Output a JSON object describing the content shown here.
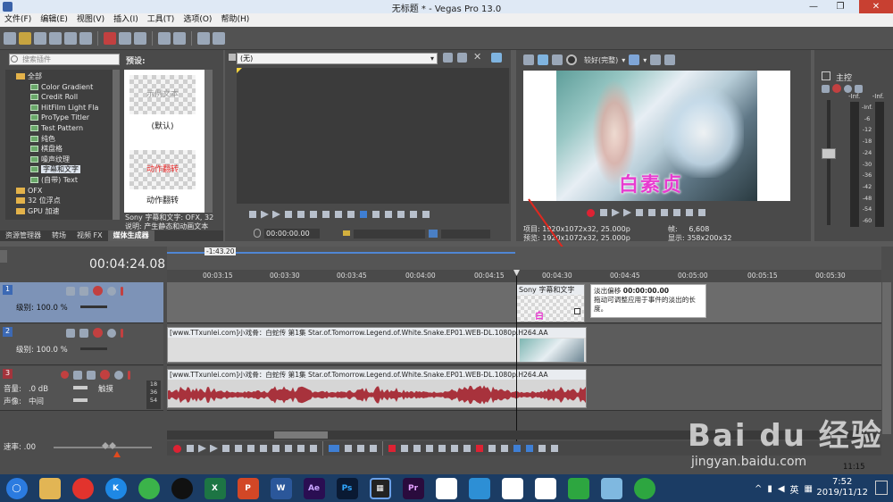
{
  "window": {
    "title": "无标题 * - Vegas Pro 13.0"
  },
  "menu": [
    "文件(F)",
    "编辑(E)",
    "视图(V)",
    "插入(I)",
    "工具(T)",
    "选项(O)",
    "帮助(H)"
  ],
  "explorer": {
    "search_placeholder": "搜索插件",
    "preset_label": "预设:",
    "tree": [
      "全部",
      "Color Gradient",
      "Credit Roll",
      "HitFilm Light Fla",
      "ProType Titler",
      "Test Pattern",
      "纯色",
      "棋盘格",
      "噪声纹理",
      "字幕和文字",
      "(自带) Text",
      "OFX",
      "32 位浮点",
      "GPU 加速"
    ],
    "presets": [
      {
        "thumb_text": "示例文本",
        "label": "(默认)"
      },
      {
        "thumb_text": "动作翻转",
        "label": "动作翻转"
      }
    ],
    "info_line1": "Sony 字幕和文字: OFX, 32",
    "info_line2": "说明: 产生静态和动画文本",
    "tabs": [
      "资源管理器",
      "转场",
      "视频 FX",
      "媒体生成器"
    ]
  },
  "trimmer": {
    "dropdown_value": "(无)",
    "timecode": "00:00:00.00"
  },
  "preview": {
    "quality": "较好(完整)",
    "caption": "白素贞",
    "project_label": "项目:",
    "project_value": "1920x1072x32, 25.000p",
    "preview_label": "预览:",
    "preview_value": "1920x1072x32, 25.000p",
    "frame_label": "帧:",
    "frame_value": "6,608",
    "display_label": "显示:",
    "display_value": "358x200x32"
  },
  "master": {
    "label": "主控",
    "scale": [
      "-Inf.",
      "-6",
      "-12",
      "-18",
      "-24",
      "-30",
      "-36",
      "-42",
      "-48",
      "-54",
      "-60"
    ],
    "top_values": [
      "-Inf.",
      "-Inf."
    ]
  },
  "timeline": {
    "time": "00:04:24.08",
    "region_label": "-1:43.20",
    "ticks": [
      "00:03:15",
      "00:03:30",
      "00:03:45",
      "00:04:00",
      "00:04:15",
      "00:04:30",
      "00:04:45",
      "00:05:00",
      "00:05:15",
      "00:05:30"
    ],
    "tracks": [
      {
        "num": "1",
        "level": "级别: 100.0 %"
      },
      {
        "num": "2",
        "level": "级别: 100.0 %"
      },
      {
        "num": "3",
        "vol": "音量:",
        "vol_val": ".0 dB",
        "pan": "声像:",
        "pan_val": "中间",
        "mode": "触摸",
        "meter": [
          "18",
          "36",
          "54"
        ]
      }
    ],
    "event_title": "Sony 字幕和文字",
    "clip_name": "[www.TTxunlei.com]小戏骨：白蛇传 第1集 Star.of.Tomorrow.Legend.of.White.Snake.EP01.WEB-DL.1080p.H264.AA",
    "tooltip_title": "淡出偏移",
    "tooltip_time": "00:00:00.00",
    "tooltip_desc": "拖动可调整应用于事件的淡出的长度。",
    "rate": "速率: .00",
    "end_time": "11:15"
  },
  "taskbar": {
    "apps": [
      "Ae",
      "Ps",
      "Pr",
      "X",
      "P",
      "W"
    ],
    "ime": "英",
    "time": "7:52",
    "date": "2019/11/12"
  },
  "watermark": {
    "brand": "Bai du 经验",
    "url": "jingyan.baidu.com"
  },
  "colors": {
    "accent": "#7d93b7",
    "audio_wave": "#a8323c",
    "caption": "#e83bd0"
  }
}
